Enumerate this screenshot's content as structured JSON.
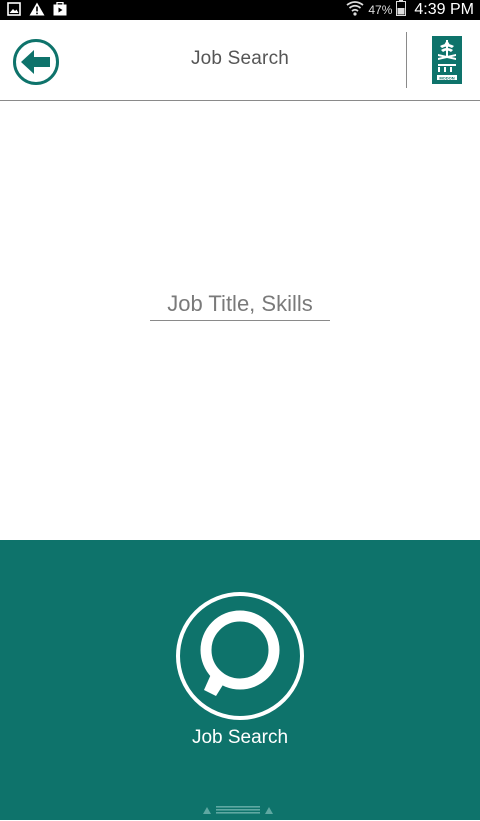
{
  "status_bar": {
    "left_icons": [
      "image-icon",
      "warning-icon",
      "video-icon"
    ],
    "right_icons": [
      "wifi-icon",
      "battery-icon"
    ],
    "battery_percent": "47%",
    "time": "4:39 PM"
  },
  "header": {
    "title": "Job Search",
    "back_icon": "back-arrow-icon",
    "logo_name": "modon-logo",
    "logo_text": "MODON"
  },
  "search": {
    "placeholder": "Job Title, Skills",
    "value": ""
  },
  "action": {
    "label": "Job Search",
    "icon": "job-search-icon"
  },
  "colors": {
    "accent": "#0e736b",
    "header_text": "#555555",
    "divider": "#8a8a8a"
  }
}
